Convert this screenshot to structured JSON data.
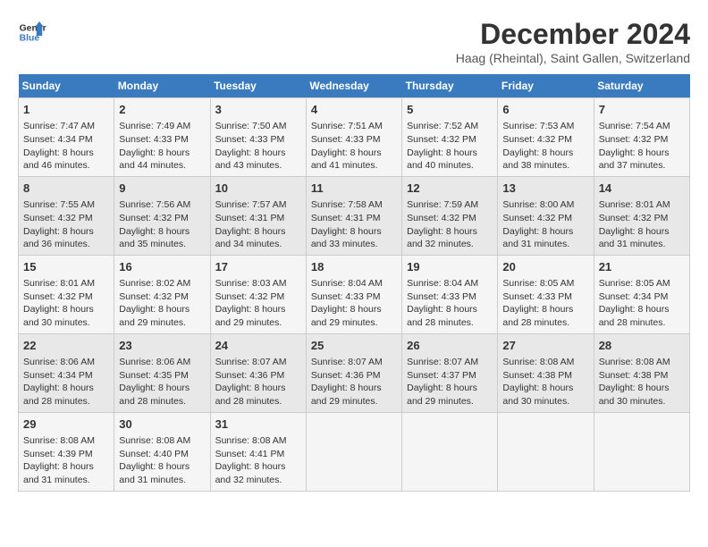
{
  "header": {
    "logo_line1": "General",
    "logo_line2": "Blue",
    "main_title": "December 2024",
    "subtitle": "Haag (Rheintal), Saint Gallen, Switzerland"
  },
  "days_of_week": [
    "Sunday",
    "Monday",
    "Tuesday",
    "Wednesday",
    "Thursday",
    "Friday",
    "Saturday"
  ],
  "weeks": [
    [
      {
        "day": "1",
        "sunrise": "Sunrise: 7:47 AM",
        "sunset": "Sunset: 4:34 PM",
        "daylight": "Daylight: 8 hours and 46 minutes."
      },
      {
        "day": "2",
        "sunrise": "Sunrise: 7:49 AM",
        "sunset": "Sunset: 4:33 PM",
        "daylight": "Daylight: 8 hours and 44 minutes."
      },
      {
        "day": "3",
        "sunrise": "Sunrise: 7:50 AM",
        "sunset": "Sunset: 4:33 PM",
        "daylight": "Daylight: 8 hours and 43 minutes."
      },
      {
        "day": "4",
        "sunrise": "Sunrise: 7:51 AM",
        "sunset": "Sunset: 4:33 PM",
        "daylight": "Daylight: 8 hours and 41 minutes."
      },
      {
        "day": "5",
        "sunrise": "Sunrise: 7:52 AM",
        "sunset": "Sunset: 4:32 PM",
        "daylight": "Daylight: 8 hours and 40 minutes."
      },
      {
        "day": "6",
        "sunrise": "Sunrise: 7:53 AM",
        "sunset": "Sunset: 4:32 PM",
        "daylight": "Daylight: 8 hours and 38 minutes."
      },
      {
        "day": "7",
        "sunrise": "Sunrise: 7:54 AM",
        "sunset": "Sunset: 4:32 PM",
        "daylight": "Daylight: 8 hours and 37 minutes."
      }
    ],
    [
      {
        "day": "8",
        "sunrise": "Sunrise: 7:55 AM",
        "sunset": "Sunset: 4:32 PM",
        "daylight": "Daylight: 8 hours and 36 minutes."
      },
      {
        "day": "9",
        "sunrise": "Sunrise: 7:56 AM",
        "sunset": "Sunset: 4:32 PM",
        "daylight": "Daylight: 8 hours and 35 minutes."
      },
      {
        "day": "10",
        "sunrise": "Sunrise: 7:57 AM",
        "sunset": "Sunset: 4:31 PM",
        "daylight": "Daylight: 8 hours and 34 minutes."
      },
      {
        "day": "11",
        "sunrise": "Sunrise: 7:58 AM",
        "sunset": "Sunset: 4:31 PM",
        "daylight": "Daylight: 8 hours and 33 minutes."
      },
      {
        "day": "12",
        "sunrise": "Sunrise: 7:59 AM",
        "sunset": "Sunset: 4:32 PM",
        "daylight": "Daylight: 8 hours and 32 minutes."
      },
      {
        "day": "13",
        "sunrise": "Sunrise: 8:00 AM",
        "sunset": "Sunset: 4:32 PM",
        "daylight": "Daylight: 8 hours and 31 minutes."
      },
      {
        "day": "14",
        "sunrise": "Sunrise: 8:01 AM",
        "sunset": "Sunset: 4:32 PM",
        "daylight": "Daylight: 8 hours and 31 minutes."
      }
    ],
    [
      {
        "day": "15",
        "sunrise": "Sunrise: 8:01 AM",
        "sunset": "Sunset: 4:32 PM",
        "daylight": "Daylight: 8 hours and 30 minutes."
      },
      {
        "day": "16",
        "sunrise": "Sunrise: 8:02 AM",
        "sunset": "Sunset: 4:32 PM",
        "daylight": "Daylight: 8 hours and 29 minutes."
      },
      {
        "day": "17",
        "sunrise": "Sunrise: 8:03 AM",
        "sunset": "Sunset: 4:32 PM",
        "daylight": "Daylight: 8 hours and 29 minutes."
      },
      {
        "day": "18",
        "sunrise": "Sunrise: 8:04 AM",
        "sunset": "Sunset: 4:33 PM",
        "daylight": "Daylight: 8 hours and 29 minutes."
      },
      {
        "day": "19",
        "sunrise": "Sunrise: 8:04 AM",
        "sunset": "Sunset: 4:33 PM",
        "daylight": "Daylight: 8 hours and 28 minutes."
      },
      {
        "day": "20",
        "sunrise": "Sunrise: 8:05 AM",
        "sunset": "Sunset: 4:33 PM",
        "daylight": "Daylight: 8 hours and 28 minutes."
      },
      {
        "day": "21",
        "sunrise": "Sunrise: 8:05 AM",
        "sunset": "Sunset: 4:34 PM",
        "daylight": "Daylight: 8 hours and 28 minutes."
      }
    ],
    [
      {
        "day": "22",
        "sunrise": "Sunrise: 8:06 AM",
        "sunset": "Sunset: 4:34 PM",
        "daylight": "Daylight: 8 hours and 28 minutes."
      },
      {
        "day": "23",
        "sunrise": "Sunrise: 8:06 AM",
        "sunset": "Sunset: 4:35 PM",
        "daylight": "Daylight: 8 hours and 28 minutes."
      },
      {
        "day": "24",
        "sunrise": "Sunrise: 8:07 AM",
        "sunset": "Sunset: 4:36 PM",
        "daylight": "Daylight: 8 hours and 28 minutes."
      },
      {
        "day": "25",
        "sunrise": "Sunrise: 8:07 AM",
        "sunset": "Sunset: 4:36 PM",
        "daylight": "Daylight: 8 hours and 29 minutes."
      },
      {
        "day": "26",
        "sunrise": "Sunrise: 8:07 AM",
        "sunset": "Sunset: 4:37 PM",
        "daylight": "Daylight: 8 hours and 29 minutes."
      },
      {
        "day": "27",
        "sunrise": "Sunrise: 8:08 AM",
        "sunset": "Sunset: 4:38 PM",
        "daylight": "Daylight: 8 hours and 30 minutes."
      },
      {
        "day": "28",
        "sunrise": "Sunrise: 8:08 AM",
        "sunset": "Sunset: 4:38 PM",
        "daylight": "Daylight: 8 hours and 30 minutes."
      }
    ],
    [
      {
        "day": "29",
        "sunrise": "Sunrise: 8:08 AM",
        "sunset": "Sunset: 4:39 PM",
        "daylight": "Daylight: 8 hours and 31 minutes."
      },
      {
        "day": "30",
        "sunrise": "Sunrise: 8:08 AM",
        "sunset": "Sunset: 4:40 PM",
        "daylight": "Daylight: 8 hours and 31 minutes."
      },
      {
        "day": "31",
        "sunrise": "Sunrise: 8:08 AM",
        "sunset": "Sunset: 4:41 PM",
        "daylight": "Daylight: 8 hours and 32 minutes."
      },
      null,
      null,
      null,
      null
    ]
  ]
}
